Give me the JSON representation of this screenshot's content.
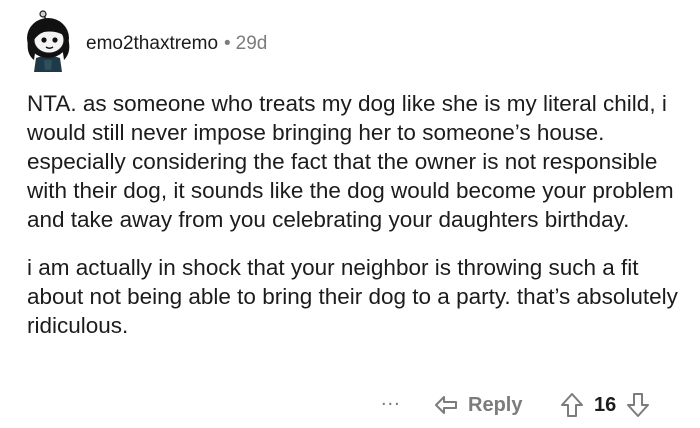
{
  "comment": {
    "username": "emo2thaxtremo",
    "separator": "•",
    "age": "29d",
    "paragraphs": [
      "NTA. as someone who treats my dog like she is my literal child, i would still never impose bringing her to someone’s house. especially considering the fact that the owner is not responsible with their dog, it sounds like the dog would become your problem and take away from you celebrating your daughters birthday.",
      "i am actually in shock that your neighbor is throwing such a fit about not being able to bring their dog to a party. that’s absolutely ridiculous."
    ]
  },
  "actions": {
    "more_label": "...",
    "reply_label": "Reply",
    "score": "16"
  },
  "icons": {
    "avatar": "snoo-avatar-icon",
    "reply": "reply-arrow-icon",
    "upvote": "upvote-arrow-icon",
    "downvote": "downvote-arrow-icon"
  }
}
